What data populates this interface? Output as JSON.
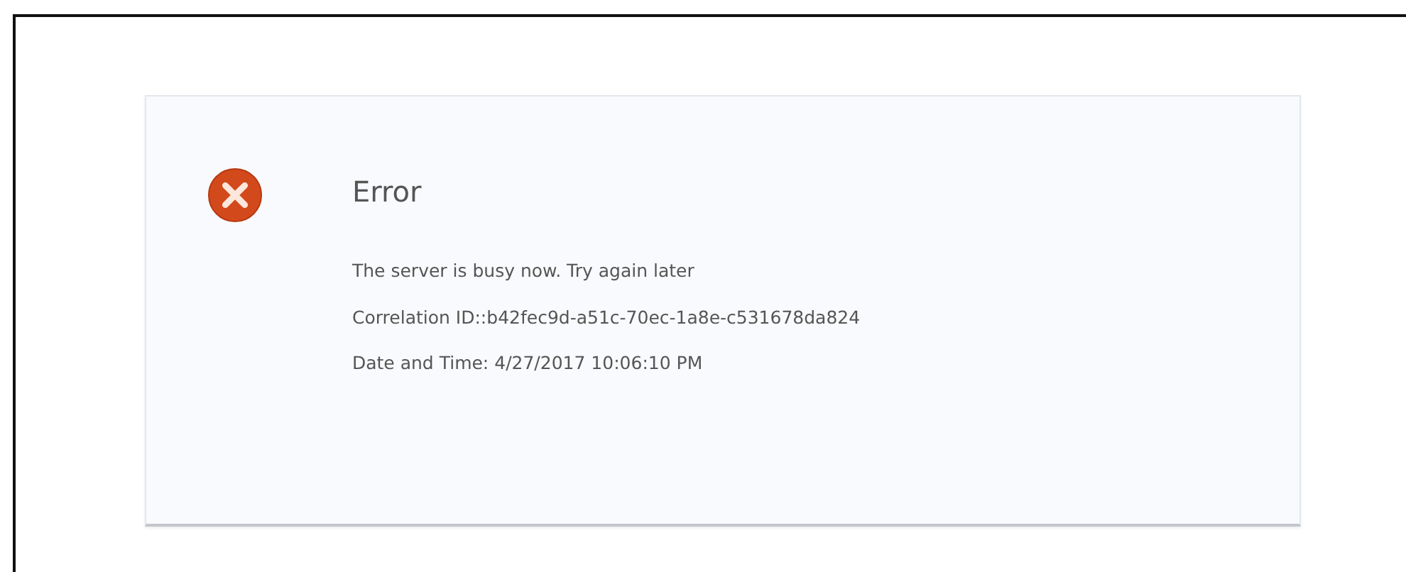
{
  "error": {
    "title": "Error",
    "lines": [
      "The server is busy now. Try again later",
      "Correlation ID::b42fec9d-a51c-70ec-1a8e-c531678da824",
      "Date and Time: 4/27/2017 10:06:10 PM"
    ]
  }
}
